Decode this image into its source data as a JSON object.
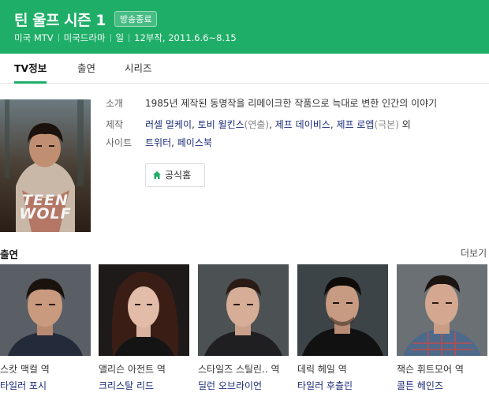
{
  "header": {
    "title": "틴 울프 시즌 1",
    "badge": "방송종료",
    "meta": [
      "미국 MTV",
      "미국드라마",
      "일",
      "12부작, 2011.6.6~8.15"
    ],
    "bg_color": "#1fae68"
  },
  "tabs": [
    {
      "label": "TV정보",
      "active": true
    },
    {
      "label": "출연",
      "active": false
    },
    {
      "label": "시리즈",
      "active": false
    }
  ],
  "poster": {
    "title_line1": "TEEN",
    "title_line2": "WOLF"
  },
  "info": {
    "synopsis_label": "소개",
    "synopsis": "1985년 제작된 동명작을 리메이크한 작품으로 늑대로 변한 인간의 이야기",
    "production_label": "제작",
    "production": {
      "director1": "러셀 멀케이",
      "director2": "토비 윌킨스",
      "director2_role": "(연출)",
      "writer1": "제프 데이비스",
      "writer2": "제프 로엡",
      "writer2_role": "(극본)",
      "suffix": "외",
      "comma": ", "
    },
    "site_label": "사이트",
    "sites": [
      "트위터",
      "페이스북"
    ],
    "home_button": "공식홈"
  },
  "cast_section": {
    "title": "출연",
    "more": "더보기"
  },
  "cast": [
    {
      "role": "스캇 맥컬 역",
      "name": "타일러 포시"
    },
    {
      "role": "앨리슨 아전트 역",
      "name": "크리스탈 리드"
    },
    {
      "role": "스타일즈 스틸린.. 역",
      "name": "딜런 오브라이언"
    },
    {
      "role": "데릭 헤일 역",
      "name": "타일러 후츨린"
    },
    {
      "role": "잭슨 휘트모어 역",
      "name": "콜튼 헤인즈"
    }
  ]
}
